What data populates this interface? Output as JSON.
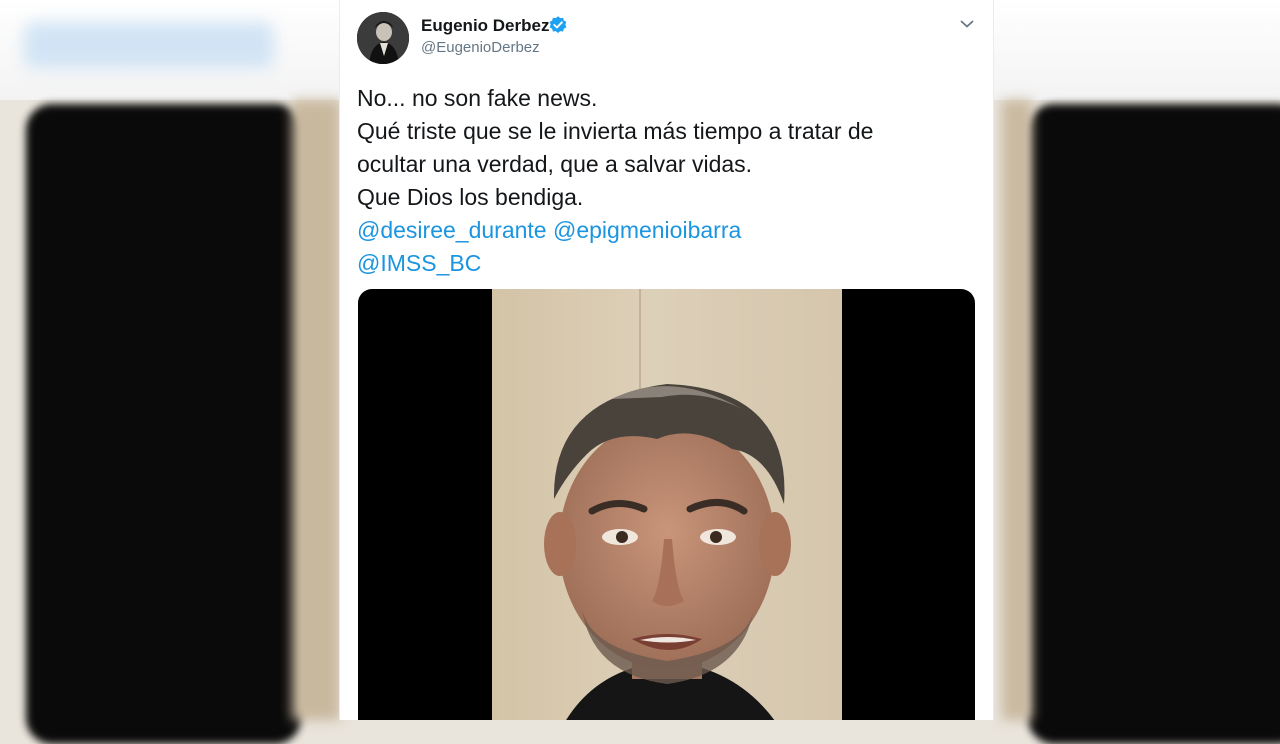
{
  "tweet": {
    "author_name": "Eugenio Derbez",
    "author_handle": "@EugenioDerbez",
    "text_lines": [
      "No... no son fake news.",
      "Qué triste que se le invierta más tiempo a tratar de",
      "ocultar una verdad, que a salvar vidas.",
      "Que Dios los bendiga."
    ],
    "mentions": [
      "@desiree_durante",
      "@epigmenioibarra",
      "@IMSS_BC"
    ],
    "icons": {
      "verified": "verified-badge-icon",
      "menu": "chevron-down-icon"
    }
  },
  "colors": {
    "link": "#1b95e0",
    "verified": "#1da1f2",
    "text": "#14171a",
    "secondary": "#657786"
  }
}
